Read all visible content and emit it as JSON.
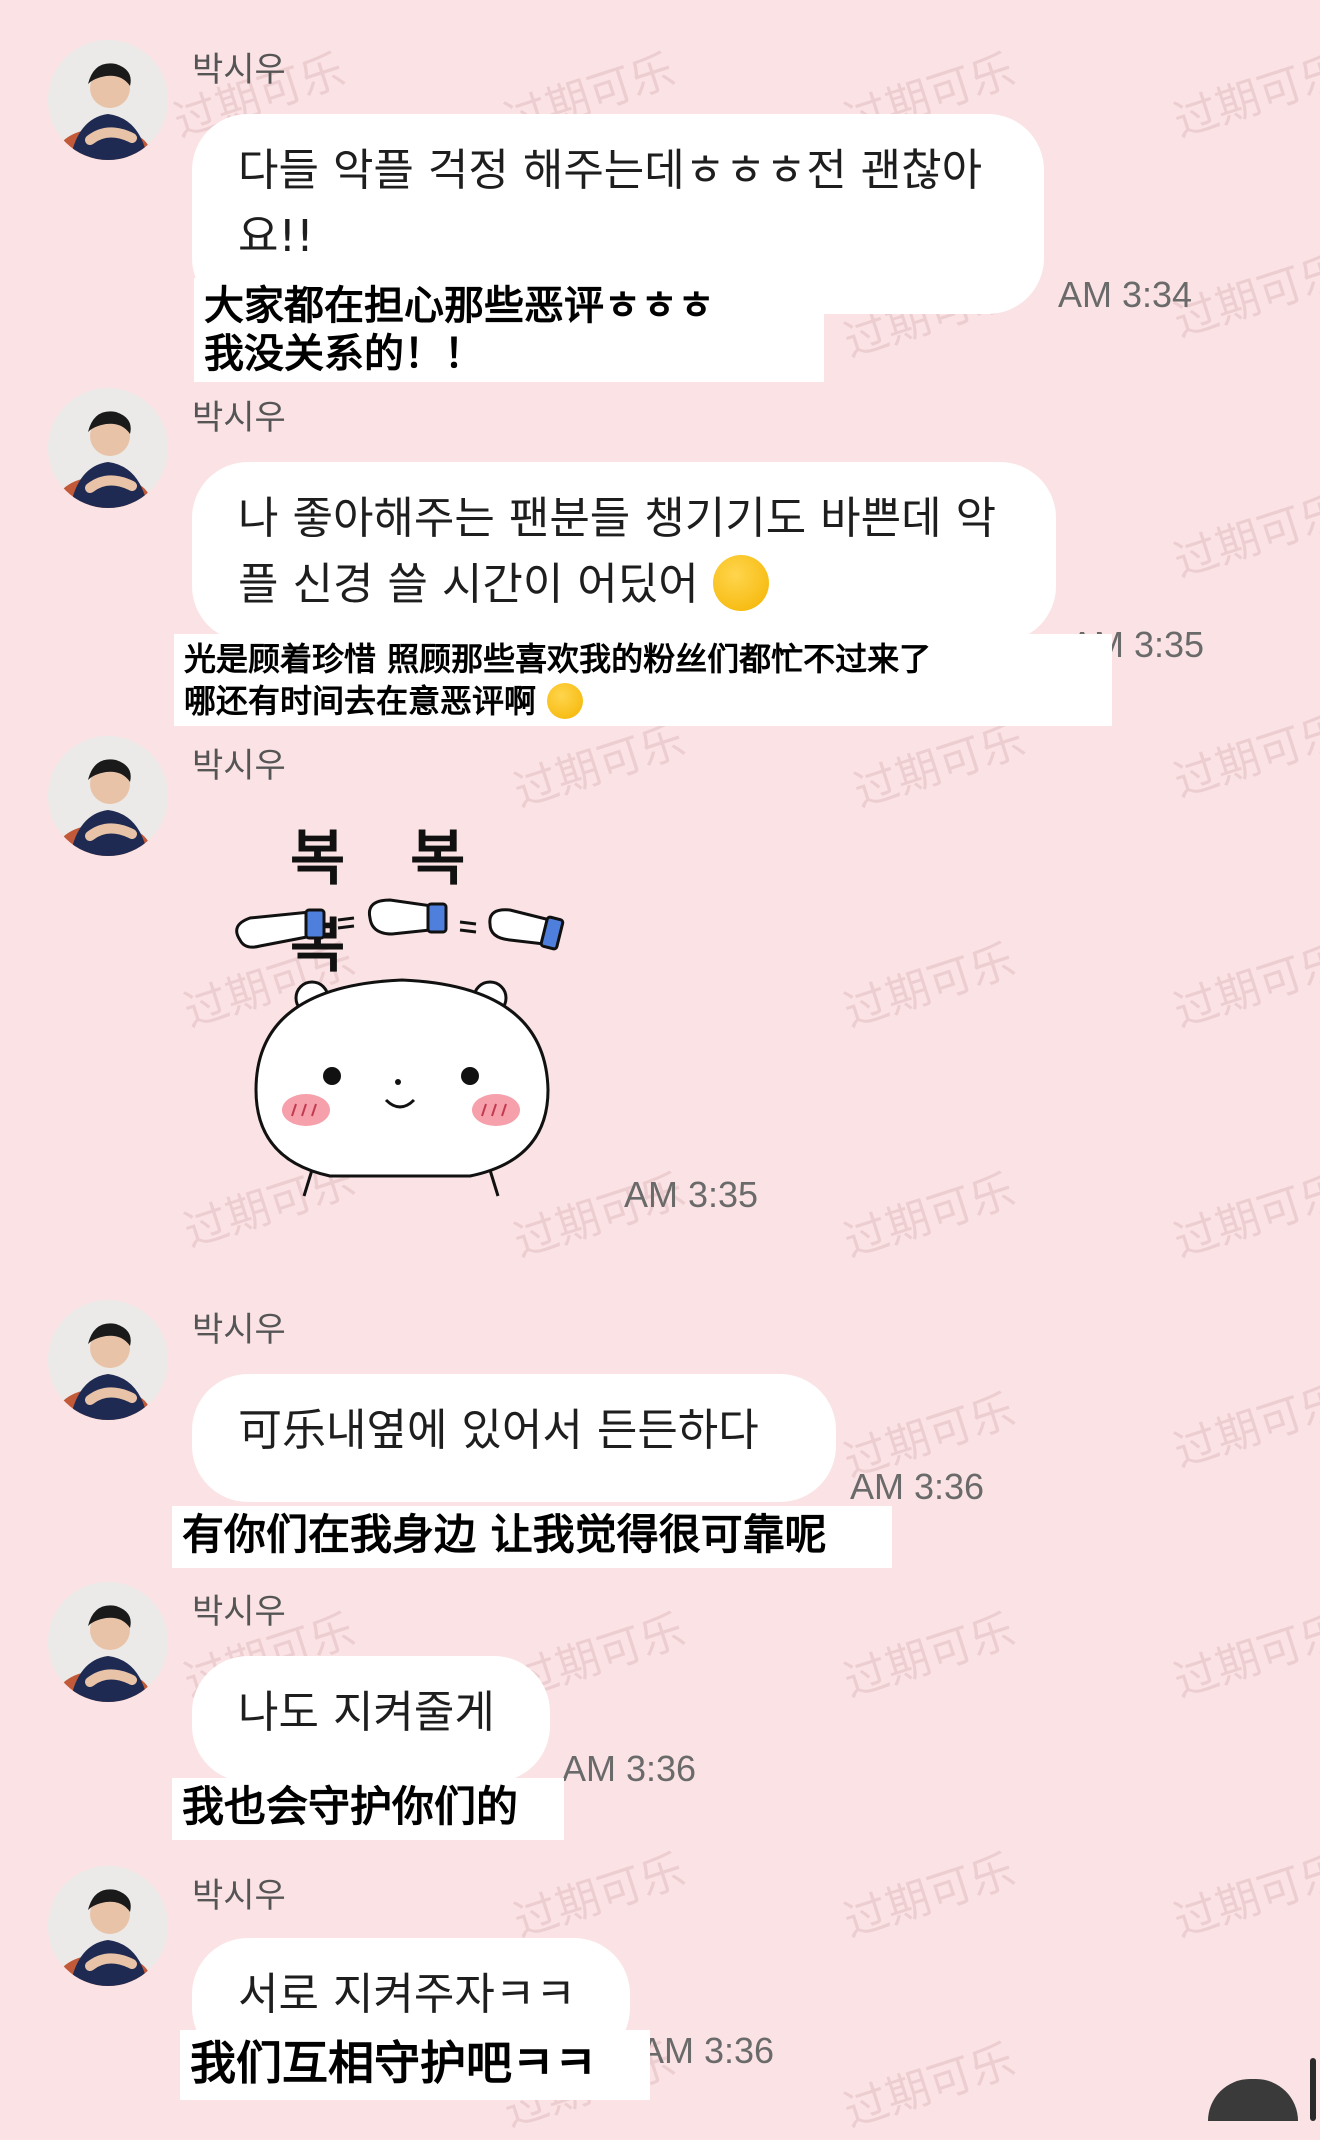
{
  "watermark": "过期可乐",
  "sender": "박시우",
  "messages": [
    {
      "text": "다들 악플 걱정 해주는데ㅎㅎㅎ전 괜찮아요!!",
      "line1": "다들 악플 걱정 해주는데ㅎㅎㅎ전 괜찮아",
      "line2": "요!!",
      "time": "AM 3:34",
      "subtitle_line1": "大家都在担心那些恶评ㅎㅎㅎ",
      "subtitle_line2": "我没关系的！！"
    },
    {
      "line1": "나 좋아해주는 팬분들 챙기기도 바쁜데 악",
      "line2": "플 신경 쓸 시간이 어딨어",
      "emoji": "hand-over-mouth-emoji",
      "time": "AM 3:35",
      "subtitle_line1": "光是顾着珍惜 照顾那些喜欢我的粉丝们都忙不过来了",
      "subtitle_line2": "哪还有时间去在意恶评啊"
    },
    {
      "sticker_text": "복 복 복",
      "sticker": "white-bear-pat-sticker",
      "time": "AM 3:35"
    },
    {
      "line1": "可乐내옆에 있어서 든든하다",
      "time": "AM 3:36",
      "subtitle_line1": "有你们在我身边 让我觉得很可靠呢"
    },
    {
      "line1": "나도 지켜줄게",
      "time": "AM 3:36",
      "subtitle_line1": "我也会守护你们的"
    },
    {
      "line1": "서로 지켜주자ㅋㅋ",
      "time": "AM 3:36",
      "subtitle_line1": "我们互相守护吧ㅋㅋ"
    }
  ],
  "colors": {
    "background": "#fbe3e5",
    "bubble": "#ffffff",
    "time": "#6a6a6a"
  }
}
